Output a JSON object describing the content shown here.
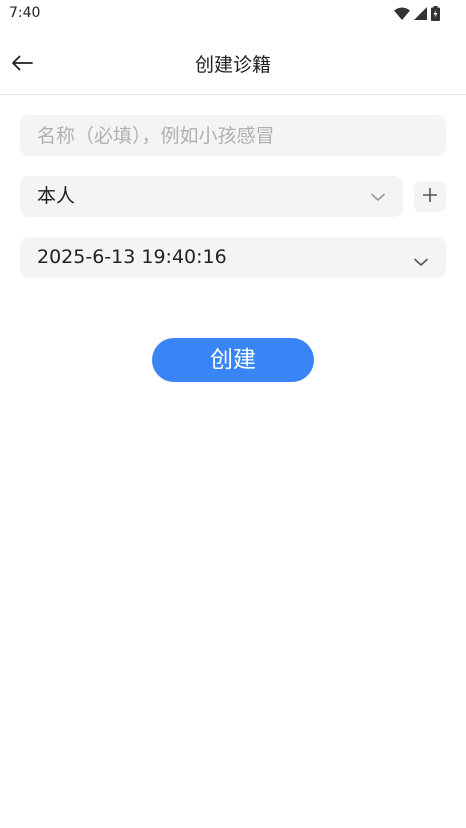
{
  "status_bar": {
    "time": "7:40",
    "icons": [
      "wifi-icon",
      "cellular-signal-icon",
      "battery-icon"
    ]
  },
  "header": {
    "title": "创建诊籍",
    "back_icon": "arrow-left-icon"
  },
  "form": {
    "name_placeholder": "名称（必填），例如小孩感冒",
    "name_value": "",
    "person_value": "本人",
    "add_icon": "plus-icon",
    "datetime_value": "2025-6-13 19:40:16",
    "create_label": "创建"
  },
  "colors": {
    "accent": "#3a85f5",
    "field_background": "#f4f4f4",
    "placeholder": "#b0b0b0"
  }
}
